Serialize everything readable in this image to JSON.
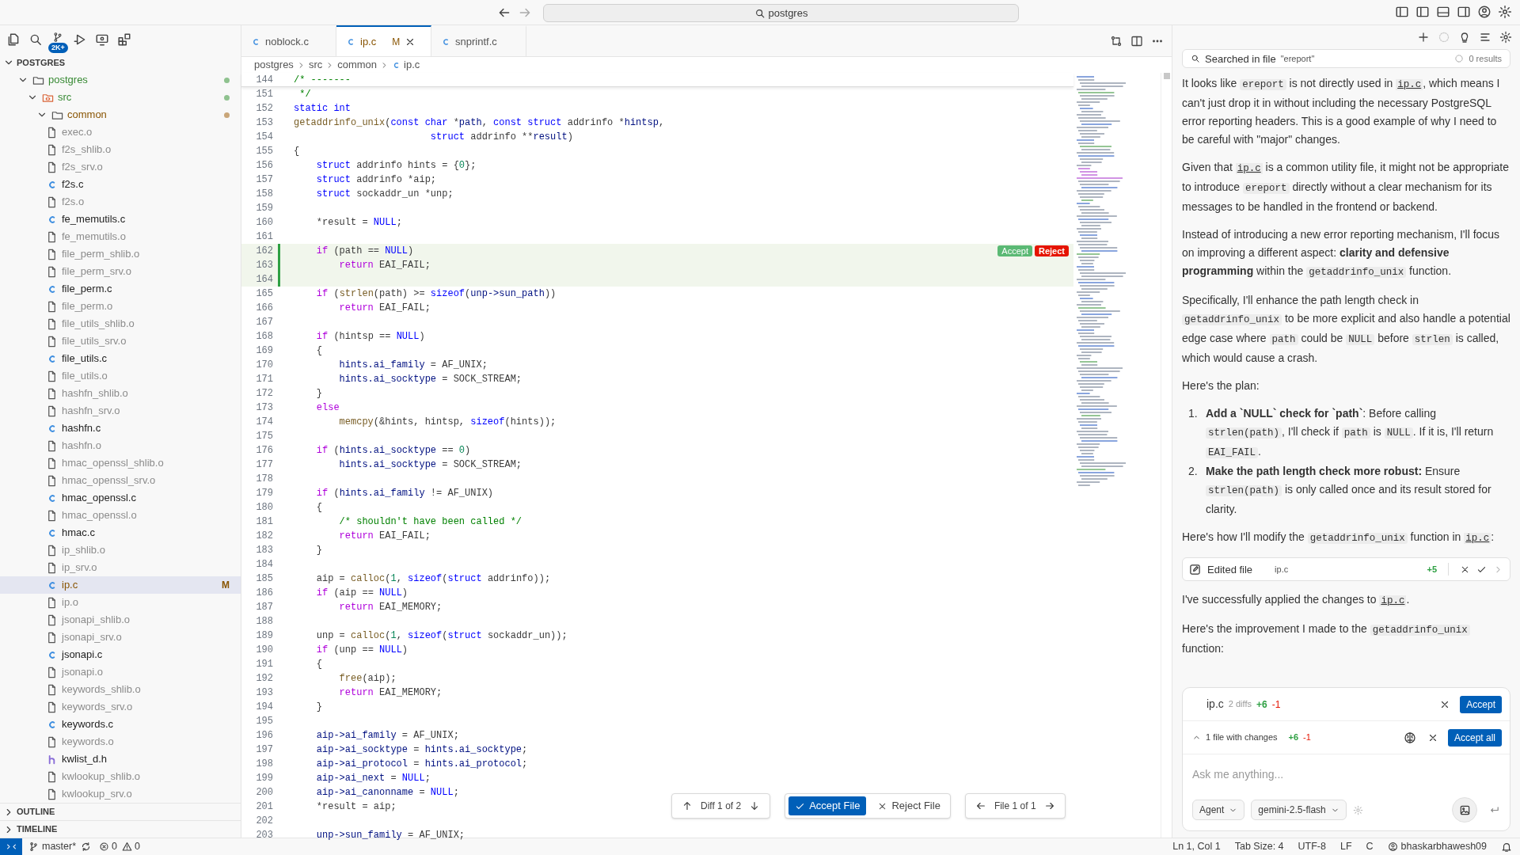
{
  "title_bar": {
    "search": "postgres"
  },
  "sidebar": {
    "scm_badge": "2K+",
    "section": "POSTGRES",
    "tree": [
      {
        "label": "postgres",
        "kind": "folder",
        "expanded": true,
        "untracked": true,
        "color": "#8fc28f",
        "children": [
          {
            "label": "src",
            "kind": "code-folder",
            "expanded": true,
            "untracked": true,
            "color": "#8fc28f",
            "children": [
              {
                "label": "common",
                "kind": "folder",
                "expanded": true,
                "modified": true,
                "color": "#c9a679",
                "children": [
                  {
                    "label": "exec.o",
                    "kind": "file",
                    "ignored": true,
                    "selected": false
                  },
                  {
                    "label": "f2s_shlib.o",
                    "kind": "file",
                    "ignored": true,
                    "selected": false
                  },
                  {
                    "label": "f2s_srv.o",
                    "kind": "file",
                    "ignored": true,
                    "selected": false
                  },
                  {
                    "label": "f2s.c",
                    "kind": "c",
                    "ignored": false,
                    "selected": false
                  },
                  {
                    "label": "f2s.o",
                    "kind": "file",
                    "ignored": true,
                    "selected": false
                  },
                  {
                    "label": "fe_memutils.c",
                    "kind": "c",
                    "ignored": false,
                    "selected": false
                  },
                  {
                    "label": "fe_memutils.o",
                    "kind": "file",
                    "ignored": true,
                    "selected": false
                  },
                  {
                    "label": "file_perm_shlib.o",
                    "kind": "file",
                    "ignored": true,
                    "selected": false
                  },
                  {
                    "label": "file_perm_srv.o",
                    "kind": "file",
                    "ignored": true,
                    "selected": false
                  },
                  {
                    "label": "file_perm.c",
                    "kind": "c",
                    "ignored": false,
                    "selected": false
                  },
                  {
                    "label": "file_perm.o",
                    "kind": "file",
                    "ignored": true,
                    "selected": false
                  },
                  {
                    "label": "file_utils_shlib.o",
                    "kind": "file",
                    "ignored": true,
                    "selected": false
                  },
                  {
                    "label": "file_utils_srv.o",
                    "kind": "file",
                    "ignored": true,
                    "selected": false
                  },
                  {
                    "label": "file_utils.c",
                    "kind": "c",
                    "ignored": false,
                    "selected": false
                  },
                  {
                    "label": "file_utils.o",
                    "kind": "file",
                    "ignored": true,
                    "selected": false
                  },
                  {
                    "label": "hashfn_shlib.o",
                    "kind": "file",
                    "ignored": true,
                    "selected": false
                  },
                  {
                    "label": "hashfn_srv.o",
                    "kind": "file",
                    "ignored": true,
                    "selected": false
                  },
                  {
                    "label": "hashfn.c",
                    "kind": "c",
                    "ignored": false,
                    "selected": false
                  },
                  {
                    "label": "hashfn.o",
                    "kind": "file",
                    "ignored": true,
                    "selected": false
                  },
                  {
                    "label": "hmac_openssl_shlib.o",
                    "kind": "file",
                    "ignored": true,
                    "selected": false
                  },
                  {
                    "label": "hmac_openssl_srv.o",
                    "kind": "file",
                    "ignored": true,
                    "selected": false
                  },
                  {
                    "label": "hmac_openssl.c",
                    "kind": "c",
                    "ignored": false,
                    "selected": false
                  },
                  {
                    "label": "hmac_openssl.o",
                    "kind": "file",
                    "ignored": true,
                    "selected": false
                  },
                  {
                    "label": "hmac.c",
                    "kind": "c",
                    "ignored": false,
                    "selected": false
                  },
                  {
                    "label": "ip_shlib.o",
                    "kind": "file",
                    "ignored": true,
                    "selected": false
                  },
                  {
                    "label": "ip_srv.o",
                    "kind": "file",
                    "ignored": true,
                    "selected": false
                  },
                  {
                    "label": "ip.c",
                    "kind": "c",
                    "ignored": false,
                    "selected": true,
                    "modified": true,
                    "badge": "M"
                  },
                  {
                    "label": "ip.o",
                    "kind": "file",
                    "ignored": true,
                    "selected": false
                  },
                  {
                    "label": "jsonapi_shlib.o",
                    "kind": "file",
                    "ignored": true,
                    "selected": false
                  },
                  {
                    "label": "jsonapi_srv.o",
                    "kind": "file",
                    "ignored": true,
                    "selected": false
                  },
                  {
                    "label": "jsonapi.c",
                    "kind": "c",
                    "ignored": false,
                    "selected": false
                  },
                  {
                    "label": "jsonapi.o",
                    "kind": "file",
                    "ignored": true,
                    "selected": false
                  },
                  {
                    "label": "keywords_shlib.o",
                    "kind": "file",
                    "ignored": true,
                    "selected": false
                  },
                  {
                    "label": "keywords_srv.o",
                    "kind": "file",
                    "ignored": true,
                    "selected": false
                  },
                  {
                    "label": "keywords.c",
                    "kind": "c",
                    "ignored": false,
                    "selected": false
                  },
                  {
                    "label": "keywords.o",
                    "kind": "file",
                    "ignored": true,
                    "selected": false
                  },
                  {
                    "label": "kwlist_d.h",
                    "kind": "h",
                    "ignored": false,
                    "selected": false
                  },
                  {
                    "label": "kwlookup_shlib.o",
                    "kind": "file",
                    "ignored": true,
                    "selected": false
                  },
                  {
                    "label": "kwlookup_srv.o",
                    "kind": "file",
                    "ignored": true,
                    "selected": false
                  }
                ]
              }
            ]
          }
        ]
      }
    ],
    "panels": [
      {
        "label": "OUTLINE",
        "expanded": false
      },
      {
        "label": "TIMELINE",
        "expanded": false
      }
    ]
  },
  "editor": {
    "tabs": [
      {
        "label": "noblock.c",
        "selected": false
      },
      {
        "label": "ip.c",
        "selected": true,
        "modified": true,
        "badge": "M"
      },
      {
        "label": "snprintf.c",
        "selected": false
      }
    ],
    "breadcrumb": [
      "postgres",
      "src",
      "common",
      "ip.c"
    ],
    "sticky": {
      "n": "144",
      "code": [
        {
          "kind": "comment",
          "text": "/* -------"
        }
      ]
    },
    "lines": [
      {
        "n": "151",
        "added": false,
        "code": [
          {
            "kind": "comment",
            "text": " */"
          }
        ]
      },
      {
        "n": "152",
        "added": false,
        "code": [
          {
            "kind": "keyword",
            "text": "static int"
          }
        ]
      },
      {
        "n": "153",
        "added": false,
        "code": [
          {
            "kind": "function",
            "text": "getaddrinfo_unix"
          },
          {
            "kind": "plain",
            "text": "("
          },
          {
            "kind": "keyword",
            "text": "const char"
          },
          {
            "kind": "plain",
            "text": " *"
          },
          {
            "kind": "variable",
            "text": "path"
          },
          {
            "kind": "plain",
            "text": ", "
          },
          {
            "kind": "keyword",
            "text": "const struct"
          },
          {
            "kind": "plain",
            "text": " addrinfo *"
          },
          {
            "kind": "variable",
            "text": "hintsp"
          },
          {
            "kind": "plain",
            "text": ","
          }
        ]
      },
      {
        "n": "154",
        "added": false,
        "code": [
          {
            "kind": "keyword",
            "text": "                        struct"
          },
          {
            "kind": "plain",
            "text": " addrinfo **"
          },
          {
            "kind": "variable",
            "text": "result"
          },
          {
            "kind": "plain",
            "text": ")"
          }
        ]
      },
      {
        "n": "155",
        "added": false,
        "code": [
          {
            "kind": "plain",
            "text": "{"
          }
        ]
      },
      {
        "n": "156",
        "added": false,
        "code": [
          {
            "kind": "keyword",
            "text": "    struct"
          },
          {
            "kind": "plain",
            "text": " addrinfo hints = {"
          },
          {
            "kind": "number",
            "text": "0"
          },
          {
            "kind": "plain",
            "text": "};"
          }
        ]
      },
      {
        "n": "157",
        "added": false,
        "code": [
          {
            "kind": "keyword",
            "text": "    struct"
          },
          {
            "kind": "plain",
            "text": " addrinfo *aip;"
          }
        ]
      },
      {
        "n": "158",
        "added": false,
        "code": [
          {
            "kind": "keyword",
            "text": "    struct"
          },
          {
            "kind": "plain",
            "text": " sockaddr_un *unp;"
          }
        ]
      },
      {
        "n": "159",
        "added": false
      },
      {
        "n": "160",
        "added": false,
        "code": [
          {
            "kind": "plain",
            "text": "    *result = "
          },
          {
            "kind": "keyword",
            "text": "NULL"
          },
          {
            "kind": "plain",
            "text": ";"
          }
        ]
      },
      {
        "n": "161",
        "added": false
      },
      {
        "n": "162",
        "added": true,
        "code": [
          {
            "kind": "control",
            "text": "    if"
          },
          {
            "kind": "plain",
            "text": " (path == "
          },
          {
            "kind": "keyword",
            "text": "NULL"
          },
          {
            "kind": "plain",
            "text": ")"
          }
        ]
      },
      {
        "n": "163",
        "added": true,
        "code": [
          {
            "kind": "control",
            "text": "        return"
          },
          {
            "kind": "plain",
            "text": " EAI_FAIL;"
          }
        ]
      },
      {
        "n": "164",
        "added": true
      },
      {
        "n": "165",
        "added": false,
        "code": [
          {
            "kind": "control",
            "text": "    if"
          },
          {
            "kind": "plain",
            "text": " ("
          },
          {
            "kind": "function",
            "text": "strlen"
          },
          {
            "kind": "plain",
            "text": "(path) >= "
          },
          {
            "kind": "keyword",
            "text": "sizeof"
          },
          {
            "kind": "plain",
            "text": "("
          },
          {
            "kind": "variable",
            "text": "unp->sun_path"
          },
          {
            "kind": "plain",
            "text": "))"
          }
        ]
      },
      {
        "n": "166",
        "added": false,
        "code": [
          {
            "kind": "control",
            "text": "        return"
          },
          {
            "kind": "plain",
            "text": " EAI_FAIL;"
          }
        ]
      },
      {
        "n": "167",
        "added": false
      },
      {
        "n": "168",
        "added": false,
        "code": [
          {
            "kind": "control",
            "text": "    if"
          },
          {
            "kind": "plain",
            "text": " (hintsp == "
          },
          {
            "kind": "keyword",
            "text": "NULL"
          },
          {
            "kind": "plain",
            "text": ")"
          }
        ]
      },
      {
        "n": "169",
        "added": false,
        "code": [
          {
            "kind": "plain",
            "text": "    {"
          }
        ]
      },
      {
        "n": "170",
        "added": false,
        "code": [
          {
            "kind": "variable",
            "text": "        hints.ai_family"
          },
          {
            "kind": "plain",
            "text": " = AF_UNIX;"
          }
        ]
      },
      {
        "n": "171",
        "added": false,
        "code": [
          {
            "kind": "variable",
            "text": "        hints.ai_socktype"
          },
          {
            "kind": "plain",
            "text": " = SOCK_STREAM;"
          }
        ]
      },
      {
        "n": "172",
        "added": false,
        "code": [
          {
            "kind": "plain",
            "text": "    }"
          }
        ]
      },
      {
        "n": "173",
        "added": false,
        "code": [
          {
            "kind": "control",
            "text": "    else"
          }
        ]
      },
      {
        "n": "174",
        "added": false,
        "code": [
          {
            "kind": "function",
            "text": "        memcpy"
          },
          {
            "kind": "plain",
            "text": "(&hints, hintsp, "
          },
          {
            "kind": "keyword",
            "text": "sizeof"
          },
          {
            "kind": "plain",
            "text": "(hints));"
          }
        ]
      },
      {
        "n": "175",
        "added": false
      },
      {
        "n": "176",
        "added": false,
        "code": [
          {
            "kind": "control",
            "text": "    if"
          },
          {
            "kind": "plain",
            "text": " ("
          },
          {
            "kind": "variable",
            "text": "hints.ai_socktype"
          },
          {
            "kind": "plain",
            "text": " == "
          },
          {
            "kind": "number",
            "text": "0"
          },
          {
            "kind": "plain",
            "text": ")"
          }
        ]
      },
      {
        "n": "177",
        "added": false,
        "code": [
          {
            "kind": "variable",
            "text": "        hints.ai_socktype"
          },
          {
            "kind": "plain",
            "text": " = SOCK_STREAM;"
          }
        ]
      },
      {
        "n": "178",
        "added": false
      },
      {
        "n": "179",
        "added": false,
        "code": [
          {
            "kind": "control",
            "text": "    if"
          },
          {
            "kind": "plain",
            "text": " ("
          },
          {
            "kind": "variable",
            "text": "hints.ai_family"
          },
          {
            "kind": "plain",
            "text": " != AF_UNIX)"
          }
        ]
      },
      {
        "n": "180",
        "added": false,
        "code": [
          {
            "kind": "plain",
            "text": "    {"
          }
        ]
      },
      {
        "n": "181",
        "added": false,
        "code": [
          {
            "kind": "comment",
            "text": "        /* shouldn't have been called */"
          }
        ]
      },
      {
        "n": "182",
        "added": false,
        "code": [
          {
            "kind": "control",
            "text": "        return"
          },
          {
            "kind": "plain",
            "text": " EAI_FAIL;"
          }
        ]
      },
      {
        "n": "183",
        "added": false,
        "code": [
          {
            "kind": "plain",
            "text": "    }"
          }
        ]
      },
      {
        "n": "184",
        "added": false
      },
      {
        "n": "185",
        "added": false,
        "code": [
          {
            "kind": "plain",
            "text": "    aip = "
          },
          {
            "kind": "function",
            "text": "calloc"
          },
          {
            "kind": "plain",
            "text": "("
          },
          {
            "kind": "number",
            "text": "1"
          },
          {
            "kind": "plain",
            "text": ", "
          },
          {
            "kind": "keyword",
            "text": "sizeof"
          },
          {
            "kind": "plain",
            "text": "("
          },
          {
            "kind": "keyword",
            "text": "struct"
          },
          {
            "kind": "plain",
            "text": " addrinfo));"
          }
        ]
      },
      {
        "n": "186",
        "added": false,
        "code": [
          {
            "kind": "control",
            "text": "    if"
          },
          {
            "kind": "plain",
            "text": " (aip == "
          },
          {
            "kind": "keyword",
            "text": "NULL"
          },
          {
            "kind": "plain",
            "text": ")"
          }
        ]
      },
      {
        "n": "187",
        "added": false,
        "code": [
          {
            "kind": "control",
            "text": "        return"
          },
          {
            "kind": "plain",
            "text": " EAI_MEMORY;"
          }
        ]
      },
      {
        "n": "188",
        "added": false
      },
      {
        "n": "189",
        "added": false,
        "code": [
          {
            "kind": "plain",
            "text": "    unp = "
          },
          {
            "kind": "function",
            "text": "calloc"
          },
          {
            "kind": "plain",
            "text": "("
          },
          {
            "kind": "number",
            "text": "1"
          },
          {
            "kind": "plain",
            "text": ", "
          },
          {
            "kind": "keyword",
            "text": "sizeof"
          },
          {
            "kind": "plain",
            "text": "("
          },
          {
            "kind": "keyword",
            "text": "struct"
          },
          {
            "kind": "plain",
            "text": " sockaddr_un));"
          }
        ]
      },
      {
        "n": "190",
        "added": false,
        "code": [
          {
            "kind": "control",
            "text": "    if"
          },
          {
            "kind": "plain",
            "text": " (unp == "
          },
          {
            "kind": "keyword",
            "text": "NULL"
          },
          {
            "kind": "plain",
            "text": ")"
          }
        ]
      },
      {
        "n": "191",
        "added": false,
        "code": [
          {
            "kind": "plain",
            "text": "    {"
          }
        ]
      },
      {
        "n": "192",
        "added": false,
        "code": [
          {
            "kind": "function",
            "text": "        free"
          },
          {
            "kind": "plain",
            "text": "(aip);"
          }
        ]
      },
      {
        "n": "193",
        "added": false,
        "code": [
          {
            "kind": "control",
            "text": "        return"
          },
          {
            "kind": "plain",
            "text": " EAI_MEMORY;"
          }
        ]
      },
      {
        "n": "194",
        "added": false,
        "code": [
          {
            "kind": "plain",
            "text": "    }"
          }
        ]
      },
      {
        "n": "195",
        "added": false
      },
      {
        "n": "196",
        "added": false,
        "code": [
          {
            "kind": "variable",
            "text": "    aip->ai_family"
          },
          {
            "kind": "plain",
            "text": " = AF_UNIX;"
          }
        ]
      },
      {
        "n": "197",
        "added": false,
        "code": [
          {
            "kind": "variable",
            "text": "    aip->ai_socktype"
          },
          {
            "kind": "plain",
            "text": " = "
          },
          {
            "kind": "variable",
            "text": "hints.ai_socktype"
          },
          {
            "kind": "plain",
            "text": ";"
          }
        ]
      },
      {
        "n": "198",
        "added": false,
        "code": [
          {
            "kind": "variable",
            "text": "    aip->ai_protocol"
          },
          {
            "kind": "plain",
            "text": " = "
          },
          {
            "kind": "variable",
            "text": "hints.ai_protocol"
          },
          {
            "kind": "plain",
            "text": ";"
          }
        ]
      },
      {
        "n": "199",
        "added": false,
        "code": [
          {
            "kind": "variable",
            "text": "    aip->ai_next"
          },
          {
            "kind": "plain",
            "text": " = "
          },
          {
            "kind": "keyword",
            "text": "NULL"
          },
          {
            "kind": "plain",
            "text": ";"
          }
        ]
      },
      {
        "n": "200",
        "added": false,
        "code": [
          {
            "kind": "variable",
            "text": "    aip->ai_canonname"
          },
          {
            "kind": "plain",
            "text": " = "
          },
          {
            "kind": "keyword",
            "text": "NULL"
          },
          {
            "kind": "plain",
            "text": ";"
          }
        ]
      },
      {
        "n": "201",
        "added": false,
        "code": [
          {
            "kind": "plain",
            "text": "    *result = aip;"
          }
        ]
      },
      {
        "n": "202",
        "added": false
      },
      {
        "n": "203",
        "added": false,
        "code": [
          {
            "kind": "variable",
            "text": "    unp->sun_family"
          },
          {
            "kind": "plain",
            "text": " = AF_UNIX;"
          }
        ]
      }
    ],
    "hunk_actions": {
      "accept": "Accept",
      "reject": "Reject"
    },
    "review_bar": {
      "diff": "Diff 1 of 2",
      "accept_file": "Accept File",
      "reject_file": "Reject File",
      "file": "File 1 of 1"
    }
  },
  "chat": {
    "search_result": {
      "label": "Searched in file",
      "query": "\"ereport\"",
      "count": "0 results"
    },
    "messages": [
      {
        "kind": "paragraph",
        "segments": [
          {
            "kind": "text",
            "text": "It looks like "
          },
          {
            "kind": "code",
            "text": "ereport"
          },
          {
            "kind": "text",
            "text": " is not directly used in "
          },
          {
            "kind": "link",
            "text": "ip.c"
          },
          {
            "kind": "text",
            "text": ", which means I can't just drop it in without including the necessary PostgreSQL error reporting headers. This is a good example of why I need to be careful with \"major\" changes."
          }
        ]
      },
      {
        "kind": "paragraph",
        "segments": [
          {
            "kind": "text",
            "text": "Given that "
          },
          {
            "kind": "link",
            "text": "ip.c"
          },
          {
            "kind": "text",
            "text": " is a common utility file, it might not be appropriate to introduce "
          },
          {
            "kind": "code",
            "text": "ereport"
          },
          {
            "kind": "text",
            "text": " directly without a clear mechanism for its messages to be handled in the frontend or backend."
          }
        ]
      },
      {
        "kind": "paragraph",
        "segments": [
          {
            "kind": "text",
            "text": "Instead of introducing a new error reporting mechanism, I'll focus on improving a different aspect: "
          },
          {
            "kind": "bold",
            "text": "clarity and defensive programming"
          },
          {
            "kind": "text",
            "text": " within the "
          },
          {
            "kind": "code",
            "text": "getaddrinfo_unix"
          },
          {
            "kind": "text",
            "text": " function."
          }
        ]
      },
      {
        "kind": "paragraph",
        "segments": [
          {
            "kind": "text",
            "text": "Specifically, I'll enhance the path length check in "
          },
          {
            "kind": "code",
            "text": "getaddrinfo_unix"
          },
          {
            "kind": "text",
            "text": " to be more explicit and also handle a potential edge case where "
          },
          {
            "kind": "code",
            "text": "path"
          },
          {
            "kind": "text",
            "text": " could be "
          },
          {
            "kind": "code",
            "text": "NULL"
          },
          {
            "kind": "text",
            "text": " before "
          },
          {
            "kind": "code",
            "text": "strlen"
          },
          {
            "kind": "text",
            "text": " is called, which would cause a crash."
          }
        ]
      },
      {
        "kind": "paragraph",
        "segments": [
          {
            "kind": "text",
            "text": "Here's the plan:"
          }
        ]
      },
      {
        "kind": "list",
        "items": [
          {
            "number": "1.",
            "segments": [
              {
                "kind": "bold",
                "text": "Add a `NULL` check for `path`"
              },
              {
                "kind": "text",
                "text": ": Before calling "
              },
              {
                "kind": "code",
                "text": "strlen(path)"
              },
              {
                "kind": "text",
                "text": ", I'll check if "
              },
              {
                "kind": "code",
                "text": "path"
              },
              {
                "kind": "text",
                "text": " is "
              },
              {
                "kind": "code",
                "text": "NULL"
              },
              {
                "kind": "text",
                "text": ". If it is, I'll return "
              },
              {
                "kind": "code",
                "text": "EAI_FAIL"
              },
              {
                "kind": "text",
                "text": "."
              }
            ]
          },
          {
            "number": "2.",
            "segments": [
              {
                "kind": "bold",
                "text": "Make the path length check more robust:"
              },
              {
                "kind": "text",
                "text": " Ensure "
              },
              {
                "kind": "code",
                "text": "strlen(path)"
              },
              {
                "kind": "text",
                "text": " is only called once and its result stored for clarity."
              }
            ]
          }
        ]
      },
      {
        "kind": "paragraph",
        "segments": [
          {
            "kind": "text",
            "text": "Here's how I'll modify the "
          },
          {
            "kind": "code",
            "text": "getaddrinfo_unix"
          },
          {
            "kind": "text",
            "text": " function in "
          },
          {
            "kind": "link",
            "text": "ip.c"
          },
          {
            "kind": "text",
            "text": ":"
          }
        ]
      },
      {
        "kind": "edit",
        "label": "Edited file",
        "file": "ip.c",
        "added": "+5"
      },
      {
        "kind": "paragraph",
        "segments": [
          {
            "kind": "text",
            "text": "I've successfully applied the changes to "
          },
          {
            "kind": "link",
            "text": "ip.c"
          },
          {
            "kind": "text",
            "text": "."
          }
        ]
      },
      {
        "kind": "paragraph",
        "segments": [
          {
            "kind": "text",
            "text": "Here's the improvement I made to the "
          },
          {
            "kind": "code",
            "text": "getaddrinfo_unix"
          },
          {
            "kind": "text",
            "text": " function:"
          }
        ]
      }
    ],
    "pending": {
      "file": "ip.c",
      "diffs": "2 diffs",
      "added": "+6",
      "removed": "-1",
      "accept": "Accept"
    },
    "summary": {
      "label": "1 file with changes",
      "added": "+6",
      "removed": "-1",
      "accept_all": "Accept all"
    },
    "input": {
      "placeholder": "Ask me anything..."
    },
    "mode": "Agent",
    "model": "gemini-2.5-flash"
  },
  "status_bar": {
    "branch": "master*",
    "errors": "0",
    "warnings": "0",
    "position": "Ln 1, Col 1",
    "tab_size": "Tab Size: 4",
    "encoding": "UTF-8",
    "eol": "LF",
    "language": "C",
    "account": "bhaskarbhawesh09"
  }
}
